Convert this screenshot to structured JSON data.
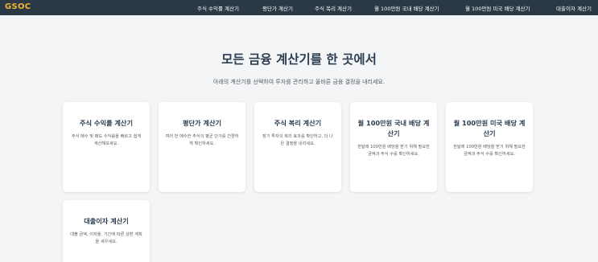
{
  "navbar": {
    "logo": "GSOC",
    "items": [
      {
        "label": "주식 수익률 계산기"
      },
      {
        "label": "평단가 계산기"
      },
      {
        "label": "주식 복리 계산기"
      },
      {
        "label": "월 100만원 국내 배당 계산기"
      },
      {
        "label": "월 100만원 미국 배당 계산기"
      },
      {
        "label": "대출이자 계산기"
      }
    ]
  },
  "hero": {
    "title": "모든 금융 계산기를 한 곳에서",
    "subtitle": "아래의 계산기를 선택하여 투자를 관리하고 올바른 금융 결정을 내리세요."
  },
  "cards": [
    {
      "title": "주식 수익률 계산기",
      "description": "주식 매수 및 매도 수익률을 빠르고 쉽게 계산해보세요."
    },
    {
      "title": "평단가 계산기",
      "description": "여러 번 매수한 주식의 평균 단가를 간편하게 확인하세요."
    },
    {
      "title": "주식 복리 계산기",
      "description": "장기 투자의 복리 효과를 확인하고, 더 나은 결정을 내리세요."
    },
    {
      "title": "월 100만원 국내 배당 계산기",
      "description": "한달에 100만원 배당을 받기 위해 필요한 금액과 주식 수를 확인하세요."
    },
    {
      "title": "월 100만원 미국 배당 계산기",
      "description": "한달에 100만원 배당을 받기 위해 필요한 금액과 주식 수를 확인하세요."
    },
    {
      "title": "대출이자 계산기",
      "description": "대출 금액, 이자율, 기간에 따른 상환 계획을 세우세요."
    }
  ]
}
